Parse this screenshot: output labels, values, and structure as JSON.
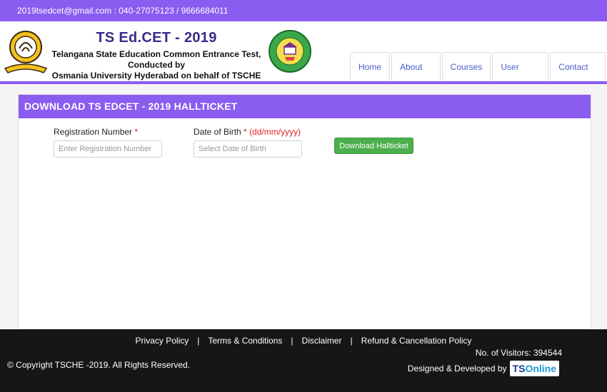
{
  "topbar": {
    "contact": "2019tsedcet@gmail.com : 040-27075123 / 9666684011"
  },
  "header": {
    "title": "TS Ed.CET - 2019",
    "subtitle_line1": "Telangana State Education Common Entrance Test, Conducted by",
    "subtitle_line2": "Osmania University Hyderabad on behalf of TSCHE",
    "right_logo_text": "TELANGANA STATE COUNCIL OF HIGHER EDUCATION"
  },
  "nav": {
    "items": [
      {
        "label": "Home"
      },
      {
        "label": "About Us"
      },
      {
        "label": "Courses"
      },
      {
        "label": "User Guide"
      },
      {
        "label": "Contact Us"
      }
    ]
  },
  "panel": {
    "title": "DOWNLOAD TS EDCET - 2019 HALLTICKET",
    "reg_label": "Registration Number",
    "reg_required": "*",
    "reg_placeholder": "Enter Registration Number",
    "dob_label": "Date of Birth",
    "dob_required": "*",
    "dob_format": "(dd/mm/yyyy)",
    "dob_placeholder": "Select Date of Birth",
    "download_button": "Download Hallticket"
  },
  "footer": {
    "links": [
      {
        "label": "Privacy Policy"
      },
      {
        "label": "Terms & Conditions"
      },
      {
        "label": "Disclaimer"
      },
      {
        "label": "Refund & Cancellation Policy"
      }
    ],
    "separator": "|",
    "copyright": "© Copyright TSCHE -2019. All Rights Reserved.",
    "visitors": "No. of Visitors: 394544",
    "designed_by": "Designed & Developed by",
    "brand_ts": "TS",
    "brand_online": "Online"
  },
  "colors": {
    "accent": "#8a5cf0",
    "button_green": "#4cae4c",
    "footer_bg": "#161616",
    "nav_text": "#4a5cc9"
  }
}
